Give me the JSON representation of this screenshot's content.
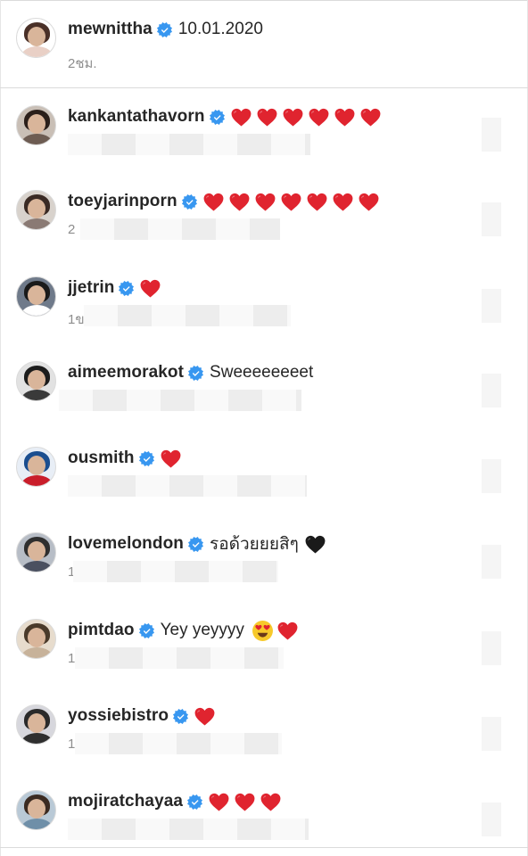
{
  "caption": {
    "username": "mewnittha",
    "text": "10.01.2020",
    "time": "2ชม."
  },
  "comments": [
    {
      "username": "kankantathavorn",
      "text": "",
      "hearts": 6,
      "heart_color": "red"
    },
    {
      "username": "toeyjarinporn",
      "text": "",
      "hearts": 7,
      "heart_color": "red",
      "meta": "2"
    },
    {
      "username": "jjetrin",
      "text": "",
      "hearts": 1,
      "heart_color": "red",
      "meta": "1ข"
    },
    {
      "username": "aimeemorakot",
      "text": "Sweeeeeeeet",
      "hearts": 0,
      "meta": ""
    },
    {
      "username": "ousmith",
      "text": "",
      "hearts": 1,
      "heart_color": "red"
    },
    {
      "username": "lovemelondon",
      "text": "รอด้วยยยสิๆ",
      "hearts": 1,
      "heart_color": "black",
      "meta": "1"
    },
    {
      "username": "pimtdao",
      "text": "Yey yeyyyy",
      "emoji": "heart-eyes",
      "hearts": 1,
      "heart_color": "red",
      "meta": "1"
    },
    {
      "username": "yossiebistro",
      "text": "",
      "hearts": 1,
      "heart_color": "red",
      "meta": "1"
    },
    {
      "username": "mojiratchayaa",
      "text": "",
      "hearts": 3,
      "heart_color": "red"
    }
  ],
  "colors": {
    "verified": "#3897f0",
    "heart_red": "#e0242f",
    "heart_black": "#1a1a1a",
    "username": "#262626",
    "meta": "#8e8e8e"
  }
}
